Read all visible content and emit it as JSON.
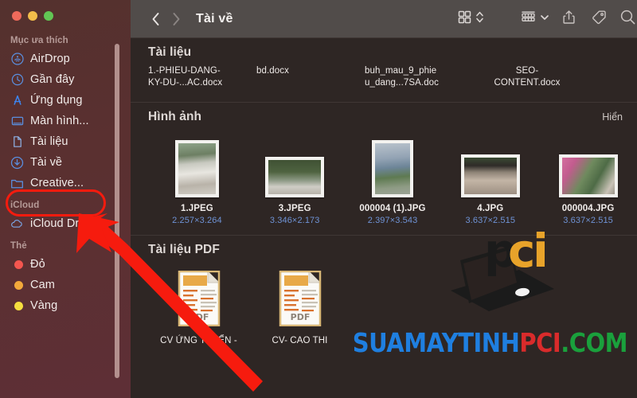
{
  "window": {
    "traffic_lights": [
      {
        "name": "close",
        "color": "#ef6a5b"
      },
      {
        "name": "minimize",
        "color": "#f2bd4a"
      },
      {
        "name": "zoom",
        "color": "#62c554"
      }
    ]
  },
  "toolbar": {
    "back_label": "‹",
    "forward_label": "›",
    "title": "Tài về",
    "icons": [
      "grid-view-icon",
      "view-chevron-updown-icon",
      "group-by-icon",
      "group-chevron-down-icon",
      "share-icon",
      "tag-icon",
      "search-icon"
    ]
  },
  "sidebar": {
    "groups": [
      {
        "header": "Mục ưa thích",
        "items": [
          {
            "label": "AirDrop",
            "icon": "airdrop-icon"
          },
          {
            "label": "Gần đây",
            "icon": "clock-icon"
          },
          {
            "label": "Ứng dụng",
            "icon": "app-store-icon"
          },
          {
            "label": "Màn hình...",
            "icon": "display-icon"
          },
          {
            "label": "Tài liệu",
            "icon": "document-icon"
          },
          {
            "label": "Tài về",
            "icon": "downloads-icon",
            "selected": true
          },
          {
            "label": "Creative...",
            "icon": "folder-icon"
          }
        ]
      },
      {
        "header": "iCloud",
        "items": [
          {
            "label": "iCloud Dri...",
            "icon": "icloud-icon"
          }
        ]
      },
      {
        "header": "Thẻ",
        "items": [
          {
            "label": "Đỏ",
            "icon": "tag-dot-icon",
            "color": "#f4564f"
          },
          {
            "label": "Cam",
            "icon": "tag-dot-icon",
            "color": "#f2a93b"
          },
          {
            "label": "Vàng",
            "icon": "tag-dot-icon",
            "color": "#f6de3f"
          }
        ]
      }
    ]
  },
  "sections": [
    {
      "title": "Tài liệu",
      "action": "",
      "documents": [
        {
          "line1": "1.-PHIEU-DANG-",
          "line2": "KY-DU-...AC.docx"
        },
        {
          "line1": "bd.docx",
          "line2": ""
        },
        {
          "line1": "buh_mau_9_phie",
          "line2": "u_dang...7SA.doc"
        },
        {
          "line1": "SEO-",
          "line2": "CONTENT.docx"
        }
      ]
    },
    {
      "title": "Hình ảnh",
      "action": "Hiển",
      "images": [
        {
          "name": "1.JPEG",
          "dims": "2.257×3.264",
          "orient": "portrait",
          "scene": "girl-bridge"
        },
        {
          "name": "3.JPEG",
          "dims": "3.346×2.173",
          "orient": "landscape",
          "scene": "park-gate"
        },
        {
          "name": "000004 (1).JPG",
          "dims": "2.397×3.543",
          "orient": "portrait",
          "scene": "city-skyline"
        },
        {
          "name": "4.JPG",
          "dims": "3.637×2.515",
          "orient": "landscape",
          "scene": "white-dog"
        },
        {
          "name": "000004.JPG",
          "dims": "3.637×2.515",
          "orient": "landscape",
          "scene": "pink-flowers"
        }
      ]
    },
    {
      "title": "Tài liệu PDF",
      "action": "",
      "pdfs": [
        {
          "name": "CV ỨNG TUYỂN -",
          "badge": "PDF"
        },
        {
          "name": "CV- CAO THI",
          "badge": "PDF"
        }
      ]
    }
  ],
  "watermark": {
    "logo_text": "pci",
    "text_part1": "SUAMAYTINH",
    "text_part2": "PCI",
    "text_part3": ".COM",
    "colors": {
      "part1": "#1f7fe0",
      "part2": "#d92b2b",
      "part3": "#1aa03c"
    }
  },
  "annotations": {
    "highlight_color": "#f61b0e",
    "highlight_target": "Tài về",
    "arrow_color": "#f61b0e"
  }
}
